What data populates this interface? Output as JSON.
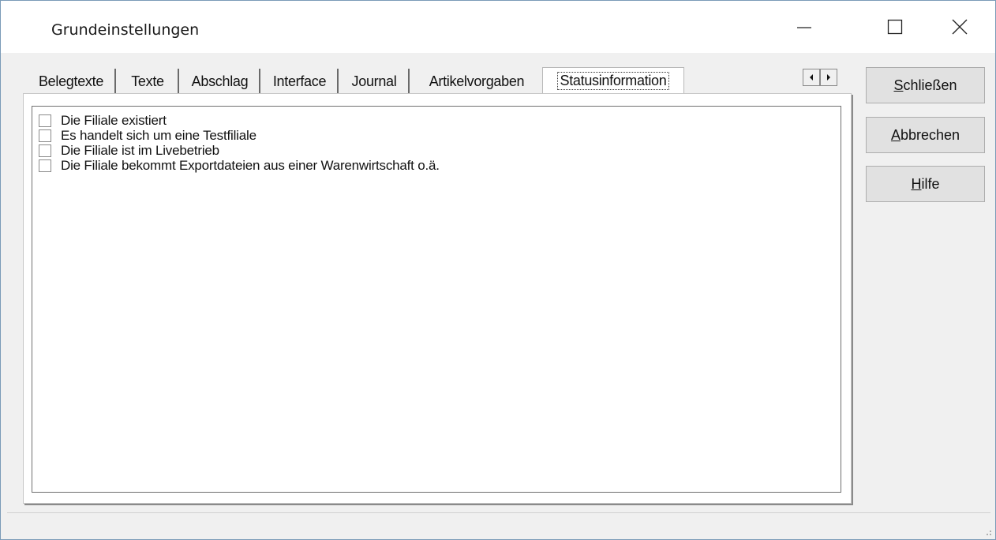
{
  "window": {
    "title": "Grundeinstellungen"
  },
  "tabs": [
    {
      "label": "Belegtexte"
    },
    {
      "label": "Texte"
    },
    {
      "label": "Abschlag"
    },
    {
      "label": "Interface"
    },
    {
      "label": "Journal"
    },
    {
      "label": "Artikelvorgaben"
    },
    {
      "label": "Statusinformation",
      "active": true
    }
  ],
  "options": [
    {
      "label": "Die Filiale existiert",
      "checked": false
    },
    {
      "label": "Es handelt sich um eine Testfiliale",
      "checked": false
    },
    {
      "label": "Die Filiale ist im Livebetrieb",
      "checked": false
    },
    {
      "label": "Die Filiale bekommt Exportdateien aus einer Warenwirtschaft o.ä.",
      "checked": false
    }
  ],
  "buttons": {
    "close": {
      "accel": "S",
      "rest": "chließen"
    },
    "cancel": {
      "accel": "A",
      "rest": "bbrechen"
    },
    "help": {
      "accel": "H",
      "rest": "ilfe"
    }
  },
  "icons": {
    "minimize": "minimize-icon",
    "maximize": "maximize-icon",
    "close": "close-icon",
    "tab_left": "arrow-left-icon",
    "tab_right": "arrow-right-icon"
  }
}
